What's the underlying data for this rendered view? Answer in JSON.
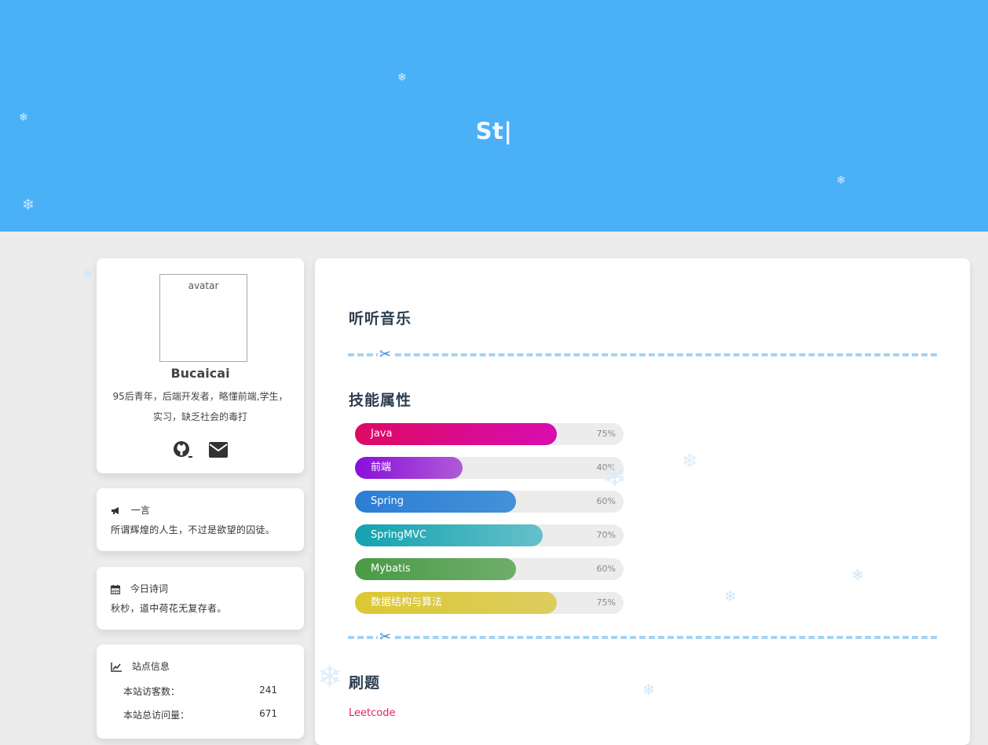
{
  "hero": {
    "title": "St|"
  },
  "profile": {
    "avatar_alt": "avatar",
    "name": "Bucaicai",
    "bio": "95后青年，后端开发者，略懂前端,学生，实习，缺乏社会的毒打",
    "social": [
      {
        "icon": "github-icon"
      },
      {
        "icon": "email-icon"
      }
    ]
  },
  "yiyan": {
    "icon": "megaphone-icon",
    "title": "一言",
    "text": "所谓辉煌的人生，不过是欲望的囚徒。"
  },
  "poem": {
    "icon": "calendar-icon",
    "title": "今日诗词",
    "text": "秋杪，道中荷花无复存者。"
  },
  "site_info": {
    "icon": "chart-line-icon",
    "title": "站点信息",
    "rows": [
      {
        "label": "本站访客数：",
        "value": "241"
      },
      {
        "label": "本站总访问量：",
        "value": "671"
      }
    ]
  },
  "main": {
    "music_title": "听听音乐",
    "skills_title": "技能属性",
    "skills": [
      {
        "name": "Java",
        "percent_label": "75%",
        "percent": 75,
        "colors": [
          "#dd0a63",
          "#d80db0"
        ]
      },
      {
        "name": "前端",
        "percent_label": "40%",
        "percent": 40,
        "colors": [
          "#8710d8",
          "#b05ad9"
        ]
      },
      {
        "name": "Spring",
        "percent_label": "60%",
        "percent": 60,
        "colors": [
          "#2c7ed4",
          "#4391d8"
        ]
      },
      {
        "name": "SpringMVC",
        "percent_label": "70%",
        "percent": 70,
        "colors": [
          "#12a2ae",
          "#65c0ca"
        ]
      },
      {
        "name": "Mybatis",
        "percent_label": "60%",
        "percent": 60,
        "colors": [
          "#4a9a45",
          "#6fae6b"
        ]
      },
      {
        "name": "数据结构与算法",
        "percent_label": "75%",
        "percent": 75,
        "colors": [
          "#dcc832",
          "#ddcd5e"
        ]
      }
    ],
    "shuati_title": "刷题",
    "leetcode_label": "Leetcode"
  },
  "colors": {
    "hero_bg": "#4ab1f7",
    "page_bg": "#ececec",
    "divider": "#a5d3f4"
  }
}
